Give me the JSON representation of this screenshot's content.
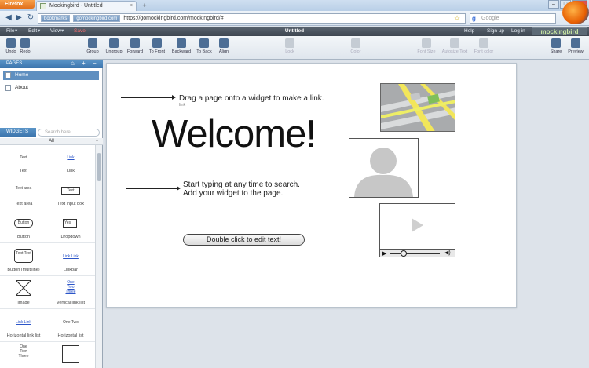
{
  "browser": {
    "menu_button": "Firefox",
    "tab_title": "Mockingbird - Untitled",
    "new_tab": "+",
    "url_chip_1": "bookmarks",
    "url_chip_2": "gomockingbird.com",
    "url": "https://gomockingbird.com/mockingbird/#",
    "search_placeholder": "Google",
    "search_engine_icon": "google-icon"
  },
  "app": {
    "menus": [
      "File",
      "Edit",
      "View"
    ],
    "save": "Save",
    "title": "Untitled",
    "right_menu": [
      "Help",
      "Sign up",
      "Log in"
    ],
    "logo": "mockingbird"
  },
  "toolbar": {
    "tools": [
      "Undo",
      "Redo",
      "Group",
      "Ungroup",
      "Forward",
      "To Front",
      "Backward",
      "To Back",
      "Align",
      "Lock",
      "Color",
      "Font Size",
      "Autosize Text",
      "Font color",
      "Share",
      "Preview"
    ]
  },
  "sidebar": {
    "pages_header": "PAGES",
    "pages": [
      "Home",
      "About"
    ],
    "widgets_header": "WIDGETS",
    "search_placeholder": "Search here",
    "filter": "All",
    "widgets": [
      {
        "label": "Text",
        "preview": "Text"
      },
      {
        "label": "Link",
        "preview": "Link"
      },
      {
        "label": "Text area",
        "preview": "Text area"
      },
      {
        "label": "Text input box",
        "preview": "Text"
      },
      {
        "label": "Button",
        "preview": "Button"
      },
      {
        "label": "Dropdown",
        "preview": "Yes"
      },
      {
        "label": "Button (multiline)",
        "preview": "Text Text"
      },
      {
        "label": "Linkbar",
        "preview": "Link Link"
      },
      {
        "label": "Image",
        "preview": ""
      },
      {
        "label": "Vertical link list",
        "preview": "One Two Three"
      },
      {
        "label": "Horizontal link list",
        "preview": "Link Link"
      },
      {
        "label": "Horizontal list",
        "preview": "One Two"
      },
      {
        "label": "",
        "preview": "One Two Three"
      },
      {
        "label": "",
        "preview": ""
      }
    ]
  },
  "canvas": {
    "hint_link": "Drag a page onto a widget to make a link.",
    "hint_link_sub": "link",
    "welcome": "Welcome!",
    "hint_search_1": "Start typing at any time to search.",
    "hint_search_2": "Add your widget to the page.",
    "button": "Double click to edit text!"
  }
}
